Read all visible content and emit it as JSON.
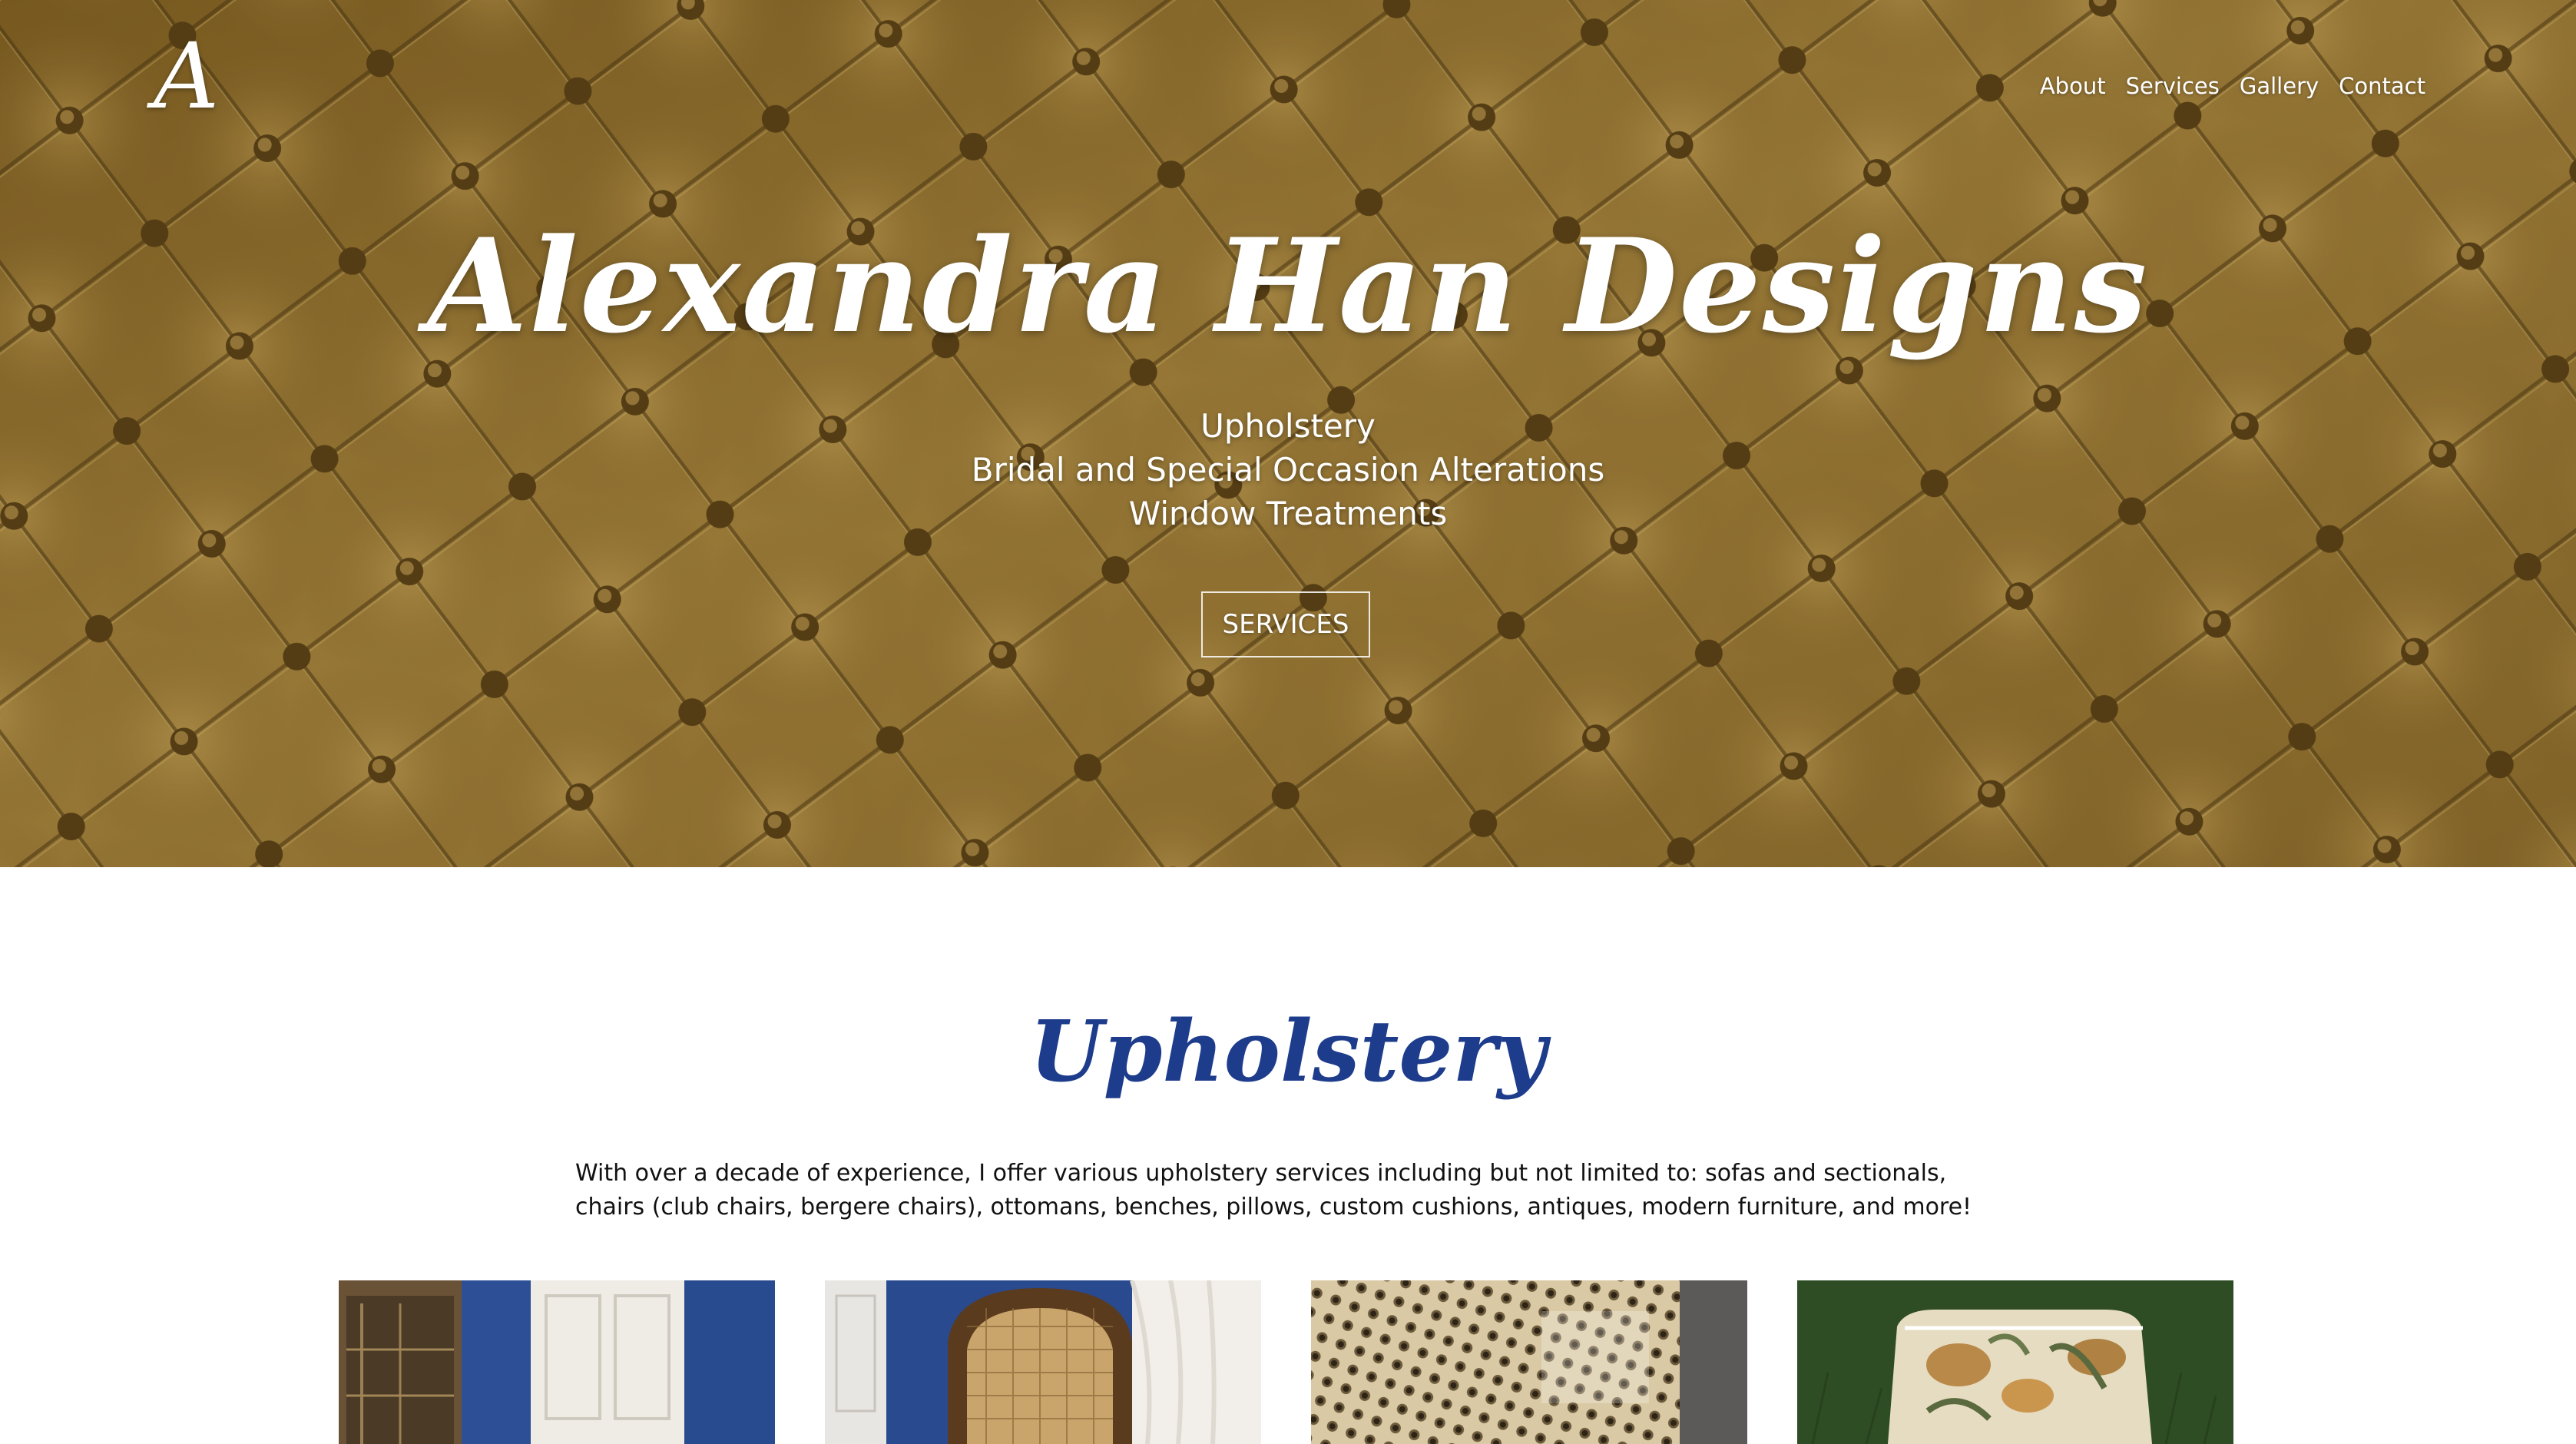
{
  "header": {
    "logo": "A",
    "nav": [
      "About",
      "Services",
      "Gallery",
      "Contact"
    ]
  },
  "hero": {
    "title": "Alexandra Han Designs",
    "lines": [
      "Upholstery",
      "Bridal and Special Occasion Alterations",
      "Window Treatments"
    ],
    "button": "SERVICES"
  },
  "upholstery": {
    "title": "Upholstery",
    "text": "With over a decade of experience, I offer various upholstery services including but not limited to: sofas and sectionals, chairs (club chairs, bergere chairs), ottomans, benches, pillows, custom cushions, antiques, modern furniture, and more!"
  },
  "colors": {
    "hero_fabric": "#8e6f2c",
    "section_title": "#1e3c8c",
    "text": "#111111",
    "background": "#ffffff"
  }
}
